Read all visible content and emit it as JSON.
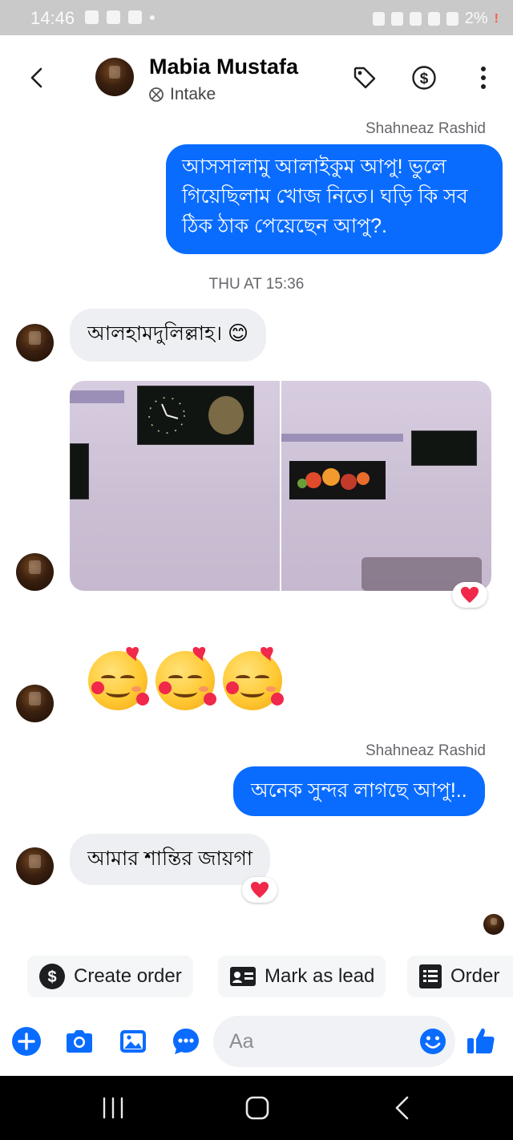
{
  "status_bar": {
    "time": "14:46",
    "battery": "2%",
    "battery_warning": "!"
  },
  "header": {
    "contact_name": "Mabia Mustafa",
    "label": "Intake"
  },
  "messages": {
    "sender_name_1": "Shahneaz Rashid",
    "outgoing_1": "আসসালামু আলাইকুম  আপু! ভুলে গিয়েছিলাম খোজ নিতে। ঘড়ি কি সব ঠিক ঠাক পেয়েছেন আপু?.",
    "timestamp": "THU AT 15:36",
    "incoming_1": "আলহামদুলিল্লাহ। 😊",
    "sender_name_2": "Shahneaz Rashid",
    "outgoing_2": "অনেক সুন্দর লাগছে আপু!..",
    "incoming_2": "আমার শান্তির জায়গা"
  },
  "quick_actions": {
    "create_order": "Create order",
    "mark_as_lead": "Mark as lead",
    "order": "Order"
  },
  "composer": {
    "placeholder": "Aa"
  },
  "colors": {
    "accent": "#0a6cff",
    "incoming_bubble": "#eeeff2",
    "reaction_heart": "#f02849"
  }
}
